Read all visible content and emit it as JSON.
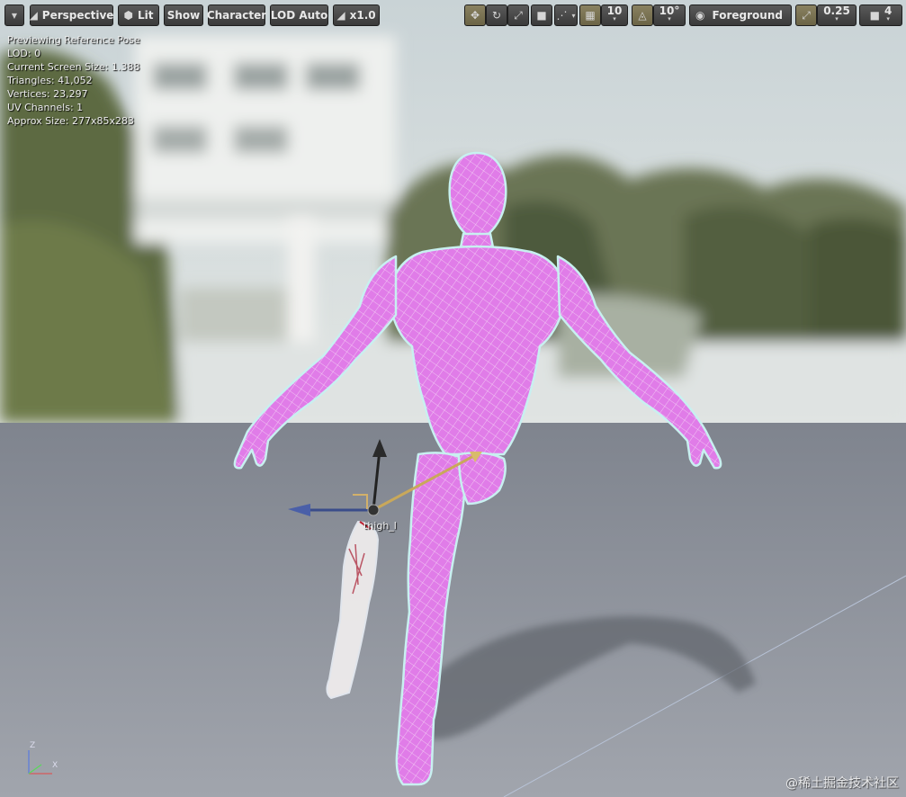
{
  "toolbar": {
    "view_mode": "Perspective",
    "lit": "Lit",
    "show": "Show",
    "character": "Character",
    "lod": "LOD Auto",
    "speed": "x1.0",
    "grid_size": "10",
    "rotation_snap": "10°",
    "layer": "Foreground",
    "scale_snap": "0.25",
    "camera_speed": "4"
  },
  "stats": [
    "Previewing Reference Pose",
    "LOD: 0",
    "Current Screen Size: 1.388",
    "Triangles: 41,052",
    "Vertices: 23,297",
    "UV Channels: 1",
    "Approx Size: 277x85x283"
  ],
  "bone_label": "thigh_l",
  "axes": {
    "z": "Z",
    "x": "X"
  },
  "watermark": "@稀土掘金技术社区",
  "colors": {
    "mesh": "#e07ce8",
    "wire": "#c8f0f0",
    "floor": "#8f939d",
    "toolbar_bg": "#4a4a4a",
    "toggle_on": "#7a7355"
  }
}
